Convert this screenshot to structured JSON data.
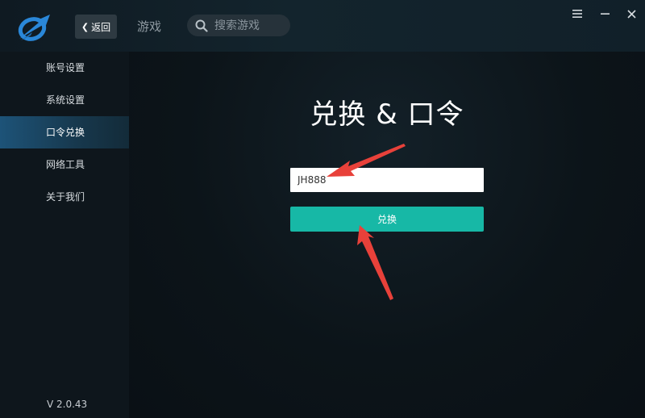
{
  "header": {
    "back_label": "返回",
    "nav_games": "游戏",
    "search_placeholder": "搜索游戏"
  },
  "sidebar": {
    "items": [
      {
        "label": "账号设置",
        "active": false
      },
      {
        "label": "系统设置",
        "active": false
      },
      {
        "label": "口令兑换",
        "active": true
      },
      {
        "label": "网络工具",
        "active": false
      },
      {
        "label": "关于我们",
        "active": false
      }
    ],
    "version": "V 2.0.43"
  },
  "main": {
    "title": "兑换 & 口令",
    "code_value": "JH888",
    "redeem_label": "兑换"
  },
  "colors": {
    "accent": "#17b8a6",
    "active_nav": "#1d5378",
    "annotation_arrow": "#e8413a"
  }
}
